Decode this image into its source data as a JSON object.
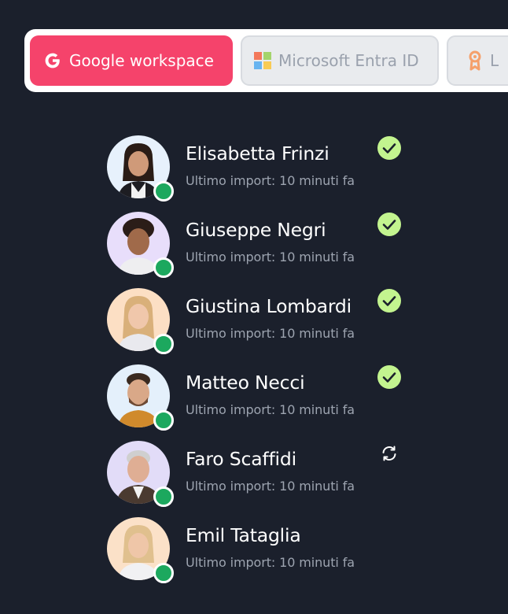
{
  "tabs": [
    {
      "label": "Google workspace",
      "icon": "google-icon",
      "active": true
    },
    {
      "label": "Microsoft Entra ID",
      "icon": "microsoft-icon",
      "active": false
    },
    {
      "label": "L",
      "icon": "badge-icon",
      "active": false
    }
  ],
  "colors": {
    "accent": "#f5436b",
    "background": "#1b202c",
    "online": "#1ca85e",
    "success": "#c3f48f"
  },
  "users": [
    {
      "name": "Elisabetta Frinzi",
      "meta": "Ultimo import: 10 minuti fa",
      "status": "done"
    },
    {
      "name": "Giuseppe Negri",
      "meta": "Ultimo import: 10 minuti fa",
      "status": "done"
    },
    {
      "name": "Giustina Lombardi",
      "meta": "Ultimo import: 10 minuti fa",
      "status": "done"
    },
    {
      "name": "Matteo Necci",
      "meta": "Ultimo import: 10 minuti fa",
      "status": "done"
    },
    {
      "name": "Faro Scaffidi",
      "meta": "Ultimo import: 10 minuti fa",
      "status": "syncing"
    },
    {
      "name": "Emil Tataglia",
      "meta": "Ultimo import: 10 minuti fa",
      "status": "none"
    }
  ]
}
